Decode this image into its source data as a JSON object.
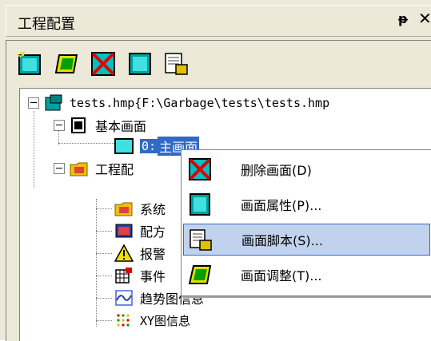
{
  "panel": {
    "title": "工程配置",
    "pin_glyph": "ᵽ",
    "close_glyph": "✕"
  },
  "toolbar": {
    "icons": [
      "new-screen-icon",
      "adjust-screen-icon",
      "delete-screen-icon",
      "screen-properties-icon",
      "screen-script-icon"
    ]
  },
  "tree": {
    "root": "tests.hmp{F:\\Garbage\\tests\\tests.hmp",
    "basic_screens": "基本画面",
    "screen0_prefix": "0:",
    "screen0_name": "主画面",
    "project_config": "工程配",
    "system": "系统",
    "recipe": "配方",
    "alarm": "报警",
    "event": "事件",
    "trend": "趋势图信息",
    "xy": "XY图信息"
  },
  "context_menu": {
    "items": [
      {
        "label": "删除画面(D)",
        "icon": "delete-screen-icon"
      },
      {
        "label": "画面属性(P)...",
        "icon": "screen-properties-icon"
      },
      {
        "label": "画面脚本(S)...",
        "icon": "screen-script-icon",
        "highlighted": true
      },
      {
        "label": "画面调整(T)...",
        "icon": "adjust-screen-icon"
      }
    ]
  },
  "colors": {
    "selection": "#316ac5",
    "menu_highlight": "#c1d2ee",
    "chrome": "#ece9d8"
  }
}
